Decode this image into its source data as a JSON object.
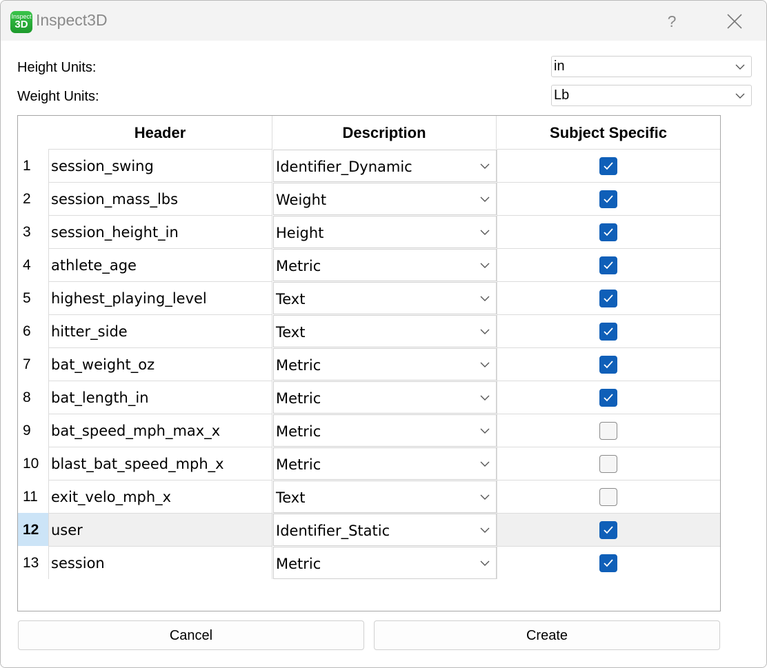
{
  "window": {
    "title": "Inspect3D",
    "icon_text_top": "Inspect",
    "icon_text_bottom": "3D",
    "help_label": "?"
  },
  "height_units": {
    "label": "Height Units:",
    "value": "in"
  },
  "weight_units": {
    "label": "Weight Units:",
    "value": "Lb"
  },
  "table": {
    "columns": [
      "Header",
      "Description",
      "Subject Specific"
    ],
    "rows": [
      {
        "num": "1",
        "header": "session_swing",
        "description": "Identifier_Dynamic",
        "subject_specific": true
      },
      {
        "num": "2",
        "header": "session_mass_lbs",
        "description": "Weight",
        "subject_specific": true
      },
      {
        "num": "3",
        "header": "session_height_in",
        "description": "Height",
        "subject_specific": true
      },
      {
        "num": "4",
        "header": "athlete_age",
        "description": "Metric",
        "subject_specific": true
      },
      {
        "num": "5",
        "header": "highest_playing_level",
        "description": "Text",
        "subject_specific": true
      },
      {
        "num": "6",
        "header": "hitter_side",
        "description": "Text",
        "subject_specific": true
      },
      {
        "num": "7",
        "header": "bat_weight_oz",
        "description": "Metric",
        "subject_specific": true
      },
      {
        "num": "8",
        "header": "bat_length_in",
        "description": "Metric",
        "subject_specific": true
      },
      {
        "num": "9",
        "header": "bat_speed_mph_max_x",
        "description": "Metric",
        "subject_specific": false
      },
      {
        "num": "10",
        "header": "blast_bat_speed_mph_x",
        "description": "Metric",
        "subject_specific": false
      },
      {
        "num": "11",
        "header": "exit_velo_mph_x",
        "description": "Text",
        "subject_specific": false
      },
      {
        "num": "12",
        "header": "user",
        "description": "Identifier_Static",
        "subject_specific": true,
        "selected": true
      },
      {
        "num": "13",
        "header": "session",
        "description": "Metric",
        "subject_specific": true
      }
    ]
  },
  "buttons": {
    "cancel": "Cancel",
    "create": "Create"
  },
  "colors": {
    "checkbox_checked": "#0f5fb8",
    "selected_row_number": "#cce4f7",
    "app_icon": "#2bb53b"
  },
  "icons": {
    "app": "inspect3d-logo",
    "help": "question-mark",
    "close": "close-x",
    "dropdown": "chevron-down",
    "check": "checkmark"
  }
}
